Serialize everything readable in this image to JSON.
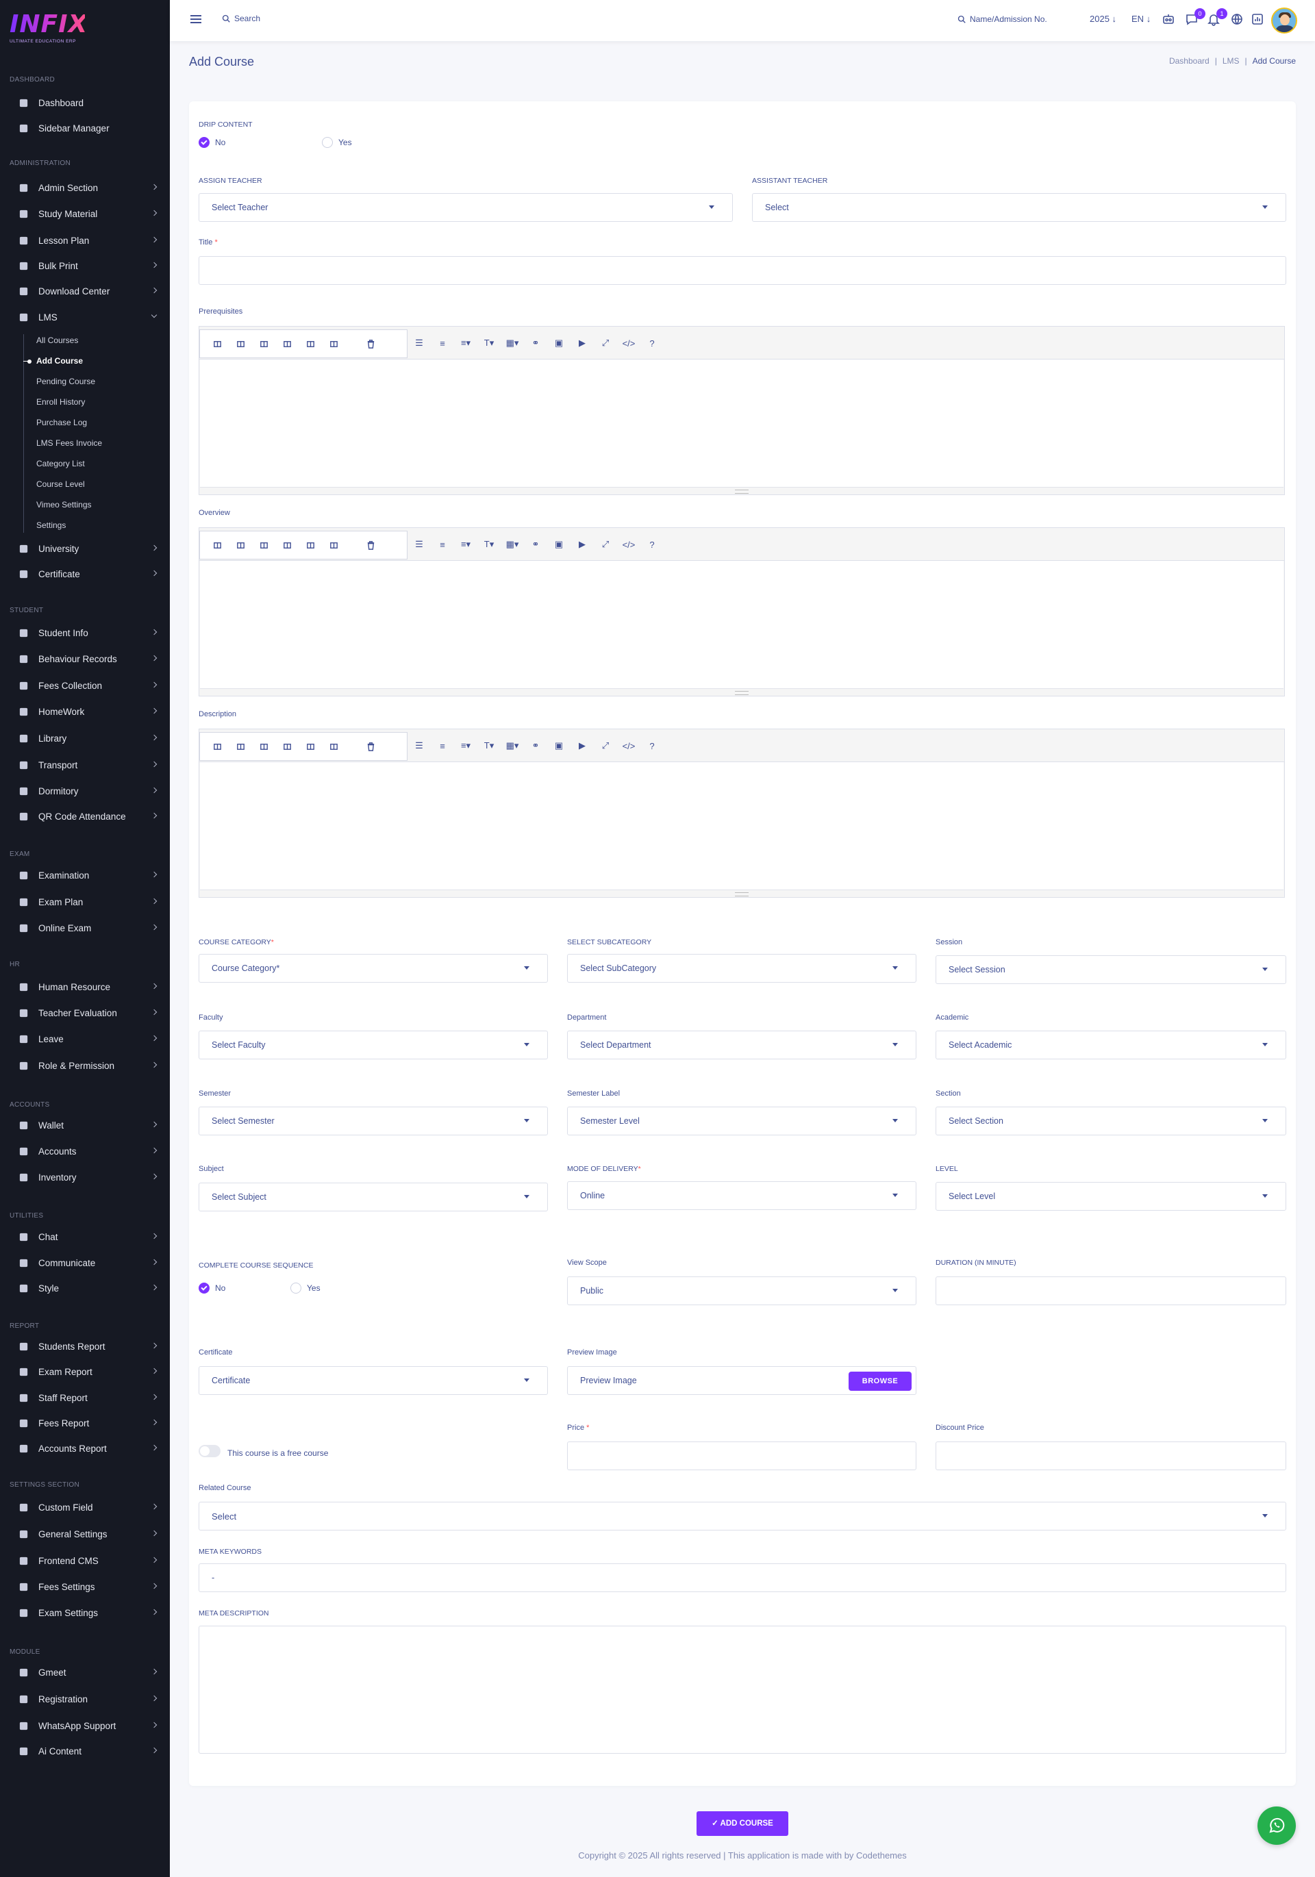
{
  "brand": {
    "logo_text": "INFIX",
    "tagline": "ULTIMATE EDUCATION ERP"
  },
  "sidebar": {
    "sections": [
      {
        "title": "DASHBOARD",
        "items": [
          {
            "label": "Dashboard",
            "icon": "grid-icon"
          },
          {
            "label": "Sidebar Manager",
            "icon": "list-icon"
          }
        ]
      },
      {
        "title": "ADMINISTRATION",
        "items": [
          {
            "label": "Admin Section",
            "icon": "admin-icon"
          },
          {
            "label": "Study Material",
            "icon": "download-icon"
          },
          {
            "label": "Lesson Plan",
            "icon": "calendar-icon"
          },
          {
            "label": "Bulk Print",
            "icon": "print-icon"
          },
          {
            "label": "Download Center",
            "icon": "download-icon"
          },
          {
            "label": "LMS",
            "icon": "graduation-icon"
          },
          {
            "label": "University",
            "icon": "university-icon"
          },
          {
            "label": "Certificate",
            "icon": "book-icon"
          }
        ]
      },
      {
        "title": "STUDENT",
        "items": [
          {
            "label": "Student Info",
            "icon": "user-icon"
          },
          {
            "label": "Behaviour Records",
            "icon": "copy-icon"
          },
          {
            "label": "Fees Collection",
            "icon": "money-icon"
          },
          {
            "label": "HomeWork",
            "icon": "book-icon"
          },
          {
            "label": "Library",
            "icon": "library-icon"
          },
          {
            "label": "Transport",
            "icon": "bus-icon"
          },
          {
            "label": "Dormitory",
            "icon": "bed-icon"
          },
          {
            "label": "QR Code Attendance",
            "icon": "qr-icon"
          }
        ]
      },
      {
        "title": "EXAM",
        "items": [
          {
            "label": "Examination",
            "icon": "map-icon"
          },
          {
            "label": "Exam Plan",
            "icon": "file-icon"
          },
          {
            "label": "Online Exam",
            "icon": "globe-icon"
          }
        ]
      },
      {
        "title": "HR",
        "items": [
          {
            "label": "Human Resource",
            "icon": "users-icon"
          },
          {
            "label": "Teacher Evaluation",
            "icon": "star-icon"
          },
          {
            "label": "Leave",
            "icon": "leave-icon"
          },
          {
            "label": "Role & Permission",
            "icon": "role-icon"
          }
        ]
      },
      {
        "title": "ACCOUNTS",
        "items": [
          {
            "label": "Wallet",
            "icon": "wallet-icon"
          },
          {
            "label": "Accounts",
            "icon": "bank-icon"
          },
          {
            "label": "Inventory",
            "icon": "inventory-icon"
          }
        ]
      },
      {
        "title": "UTILITIES",
        "items": [
          {
            "label": "Chat",
            "icon": "chat-icon"
          },
          {
            "label": "Communicate",
            "icon": "megaphone-icon"
          },
          {
            "label": "Style",
            "icon": "style-icon"
          }
        ]
      },
      {
        "title": "REPORT",
        "items": [
          {
            "label": "Students Report",
            "icon": "users-icon"
          },
          {
            "label": "Exam Report",
            "icon": "report-icon"
          },
          {
            "label": "Staff Report",
            "icon": "staff-icon"
          },
          {
            "label": "Fees Report",
            "icon": "fees-icon"
          },
          {
            "label": "Accounts Report",
            "icon": "cash-icon"
          }
        ]
      },
      {
        "title": "SETTINGS SECTION",
        "items": [
          {
            "label": "Custom Field",
            "icon": "field-icon"
          },
          {
            "label": "General Settings",
            "icon": "gears-icon"
          },
          {
            "label": "Frontend CMS",
            "icon": "cms-icon"
          },
          {
            "label": "Fees Settings",
            "icon": "gears-icon"
          },
          {
            "label": "Exam Settings",
            "icon": "gears-icon"
          }
        ]
      },
      {
        "title": "MODULE",
        "items": [
          {
            "label": "Gmeet",
            "icon": "video-icon"
          },
          {
            "label": "Registration",
            "icon": "registration-icon"
          },
          {
            "label": "WhatsApp Support",
            "icon": "whatsapp-icon"
          },
          {
            "label": "Ai Content",
            "icon": "robot-icon"
          }
        ]
      }
    ],
    "lms_sub": [
      "All Courses",
      "Add Course",
      "Pending Course",
      "Enroll History",
      "Purchase Log",
      "LMS Fees Invoice",
      "Category List",
      "Course Level",
      "Vimeo Settings",
      "Settings"
    ]
  },
  "topbar": {
    "search": "Search",
    "name_search": "Name/Admission No.",
    "year": "2025",
    "lang": "EN",
    "messages_count": "0",
    "notifications_count": "1"
  },
  "page": {
    "title": "Add Course",
    "breadcrumb": [
      "Dashboard",
      "LMS",
      "Add Course"
    ]
  },
  "form": {
    "drip": {
      "label": "DRIP CONTENT",
      "opt_no": "No",
      "opt_yes": "Yes"
    },
    "teacher": {
      "label": "ASSIGN TEACHER",
      "value": "Select Teacher"
    },
    "assistant": {
      "label": "ASSISTANT TEACHER",
      "value": "Select"
    },
    "title_label": "Title",
    "editors": [
      "Prerequisites",
      "Overview",
      "Description"
    ],
    "course_category": {
      "label": "COURSE CATEGORY",
      "value": "Course Category*"
    },
    "subcategory": {
      "label": "SELECT SUBCATEGORY",
      "value": "Select SubCategory"
    },
    "session": {
      "label": "Session",
      "value": "Select Session"
    },
    "faculty": {
      "label": "Faculty",
      "value": "Select Faculty"
    },
    "department": {
      "label": "Department",
      "value": "Select Department"
    },
    "academic": {
      "label": "Academic",
      "value": "Select Academic"
    },
    "semester": {
      "label": "Semester",
      "value": "Select Semester"
    },
    "semester_label": {
      "label": "Semester Label",
      "value": "Semester Level"
    },
    "section": {
      "label": "Section",
      "value": "Select Section"
    },
    "subject": {
      "label": "Subject",
      "value": "Select Subject"
    },
    "delivery": {
      "label": "MODE OF DELIVERY",
      "value": "Online"
    },
    "level": {
      "label": "LEVEL",
      "value": "Select Level"
    },
    "sequence": {
      "label": "COMPLETE COURSE SEQUENCE",
      "opt_no": "No",
      "opt_yes": "Yes"
    },
    "scope": {
      "label": "View Scope",
      "value": "Public"
    },
    "duration": {
      "label": "DURATION (IN MINUTE)"
    },
    "certificate": {
      "label": "Certificate",
      "value": "Certificate"
    },
    "preview": {
      "label": "Preview Image",
      "value": "Preview Image",
      "button": "BROWSE"
    },
    "free_course": "This course is a free course",
    "price": {
      "label": "Price"
    },
    "discount": {
      "label": "Discount Price"
    },
    "related": {
      "label": "Related Course",
      "value": "Select"
    },
    "meta_keywords": {
      "label": "META KEYWORDS",
      "value": "-"
    },
    "meta_description": {
      "label": "META DESCRIPTION"
    },
    "submit": "✓ ADD COURSE"
  },
  "footer": "Copyright © 2025 All rights reserved | This application is made with by Codethemes",
  "colors": {
    "accent": "#7c32ff",
    "sidebar_bg": "#161923",
    "text": "#415094"
  }
}
